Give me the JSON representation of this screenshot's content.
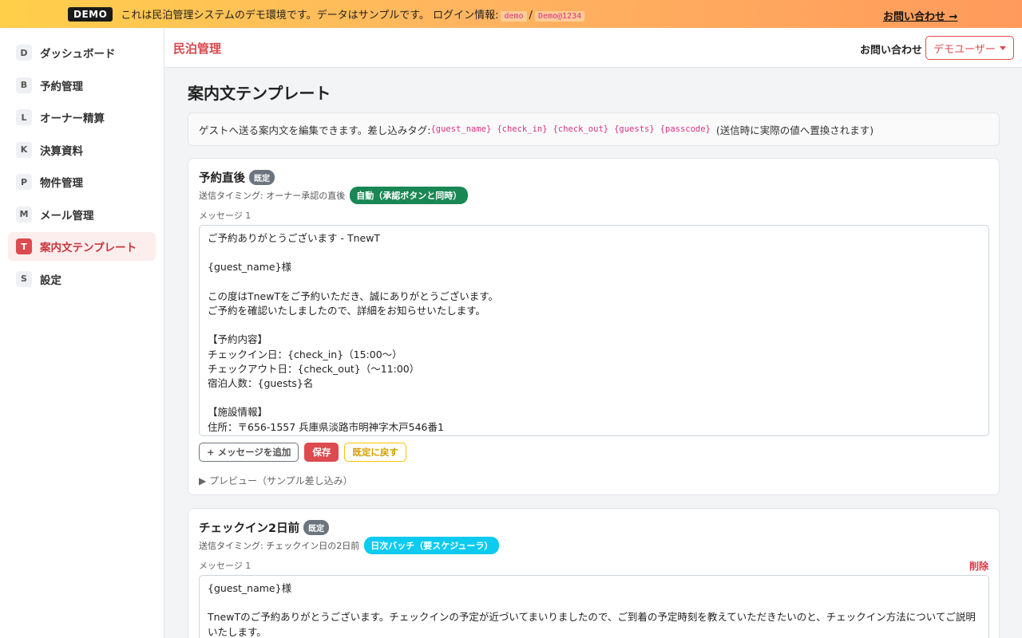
{
  "banner": {
    "badge": "DEMO",
    "text": "これは民泊管理システムのデモ環境です。データはサンプルです。 ログイン情報:",
    "user": "demo",
    "separator": "/",
    "password": "Demo@1234",
    "contact_link": "お問い合わせ →"
  },
  "sidebar": {
    "items": [
      {
        "letter": "D",
        "label": "ダッシュボード"
      },
      {
        "letter": "B",
        "label": "予約管理"
      },
      {
        "letter": "L",
        "label": "オーナー精算"
      },
      {
        "letter": "K",
        "label": "決算資料"
      },
      {
        "letter": "P",
        "label": "物件管理"
      },
      {
        "letter": "M",
        "label": "メール管理"
      },
      {
        "letter": "T",
        "label": "案内文テンプレート"
      },
      {
        "letter": "S",
        "label": "設定"
      }
    ]
  },
  "header": {
    "brand": "民泊管理",
    "contact": "お問い合わせ",
    "user_menu": "デモユーザー"
  },
  "main": {
    "title": "案内文テンプレート",
    "info_prefix": "ゲストへ送る案内文を編集できます。差し込みタグ:",
    "tags": [
      "{guest_name}",
      "{check_in}",
      "{check_out}",
      "{guests}",
      "{passcode}"
    ],
    "info_suffix": "(送信時に実際の値へ置換されます)"
  },
  "templates": [
    {
      "title": "予約直後",
      "badge": "既定",
      "timing": "送信タイミング: オーナー承認の直後",
      "timing_badge": "自動（承認ボタンと同時）",
      "message_label": "メッセージ 1",
      "message": "ご予約ありがとうございます - TnewT\n\n{guest_name}様\n\nこの度はTnewTをご予約いただき、誠にありがとうございます。\nご予約を確認いたしましたので、詳細をお知らせいたします。\n\n【予約内容】\nチェックイン日：{check_in}（15:00〜）\nチェックアウト日：{check_out}（〜11:00）\n宿泊人数：{guests}名\n\n【施設情報】\n住所：〒656-1557 兵庫県淡路市明神字木戸546番1\nGoogle Map: https://maps.app.goo.gl/",
      "add_button": "+ メッセージを追加",
      "save_button": "保存",
      "reset_button": "既定に戻す",
      "preview": "▶ プレビュー（サンプル差し込み）"
    },
    {
      "title": "チェックイン2日前",
      "badge": "既定",
      "timing": "送信タイミング: チェックイン日の2日前",
      "timing_badge": "日次バッチ（要スケジューラ）",
      "message_label": "メッセージ 1",
      "delete": "削除",
      "message": "{guest_name}様\n\nTnewTのご予約ありがとうございます。チェックインの予定が近づいてまいりましたので、ご到着の予定時刻を教えていただきたいのと、チェックイン方法についてご説明いたします。"
    }
  ],
  "colors": {
    "accent": "#dc4b50",
    "auto_badge": "#198754",
    "batch_badge": "#0dcaf0"
  }
}
